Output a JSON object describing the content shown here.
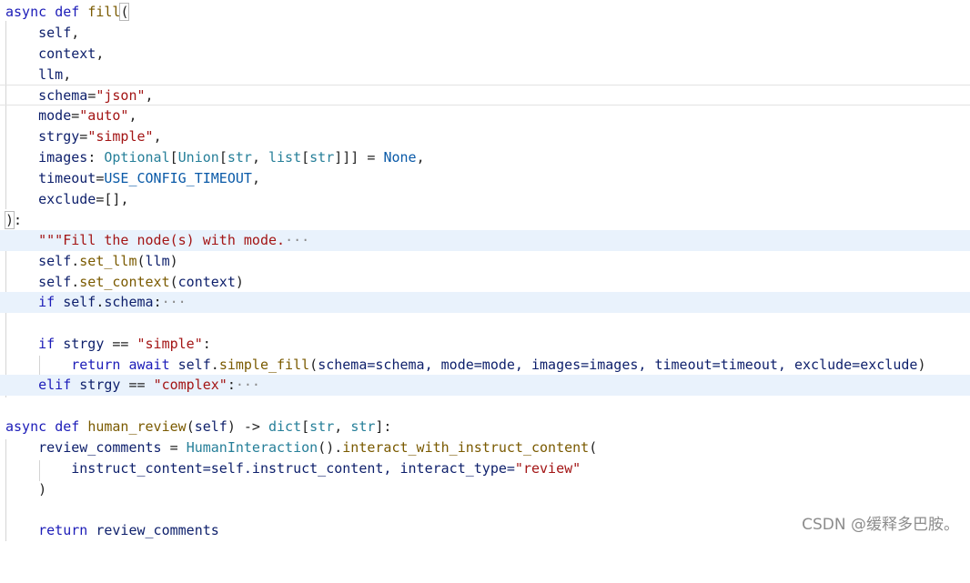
{
  "code": {
    "l1": [
      "async",
      "def",
      "fill",
      "("
    ],
    "l2": [
      "self",
      ","
    ],
    "l3": [
      "context",
      ","
    ],
    "l4": [
      "llm",
      ","
    ],
    "l5": [
      "schema",
      "=",
      "\"json\"",
      ","
    ],
    "l6": [
      "mode",
      "=",
      "\"auto\"",
      ","
    ],
    "l7": [
      "strgy",
      "=",
      "\"simple\"",
      ","
    ],
    "l8": [
      "images",
      ": ",
      "Optional",
      "[",
      "Union",
      "[",
      "str",
      ", ",
      "list",
      "[",
      "str",
      "]]]",
      " = ",
      "None",
      ","
    ],
    "l9": [
      "timeout",
      "=",
      "USE_CONFIG_TIMEOUT",
      ","
    ],
    "l10": [
      "exclude",
      "=",
      "[]",
      ","
    ],
    "l11": [
      ")",
      ":"
    ],
    "l12": [
      "\"\"\"Fill the node(s) with mode.",
      "···"
    ],
    "l13": [
      "self",
      ".",
      "set_llm",
      "(",
      "llm",
      ")"
    ],
    "l14": [
      "self",
      ".",
      "set_context",
      "(",
      "context",
      ")"
    ],
    "l15": [
      "if",
      "self",
      ".",
      "schema",
      ":",
      "···"
    ],
    "l17": [
      "if",
      "strgy",
      " == ",
      "\"simple\"",
      ":"
    ],
    "l18": [
      "return",
      "await",
      "self",
      ".",
      "simple_fill",
      "(",
      "schema=schema, mode=mode, images=images, timeout=timeout, exclude=exclude",
      ")"
    ],
    "l19": [
      "elif",
      "strgy",
      " == ",
      "\"complex\"",
      ":",
      "···"
    ],
    "l21": [
      "async",
      "def",
      "human_review",
      "(",
      "self",
      ") -> ",
      "dict",
      "[",
      "str",
      ", ",
      "str",
      "]:"
    ],
    "l22": [
      "review_comments",
      " = ",
      "HumanInteraction",
      "().",
      "interact_with_instruct_content",
      "("
    ],
    "l23": [
      "instruct_content=self.instruct_content, interact_type=",
      "\"review\""
    ],
    "l24": [
      ")"
    ],
    "l26": [
      "return",
      "review_comments"
    ]
  },
  "watermark": "CSDN @缓释多巴胺。"
}
